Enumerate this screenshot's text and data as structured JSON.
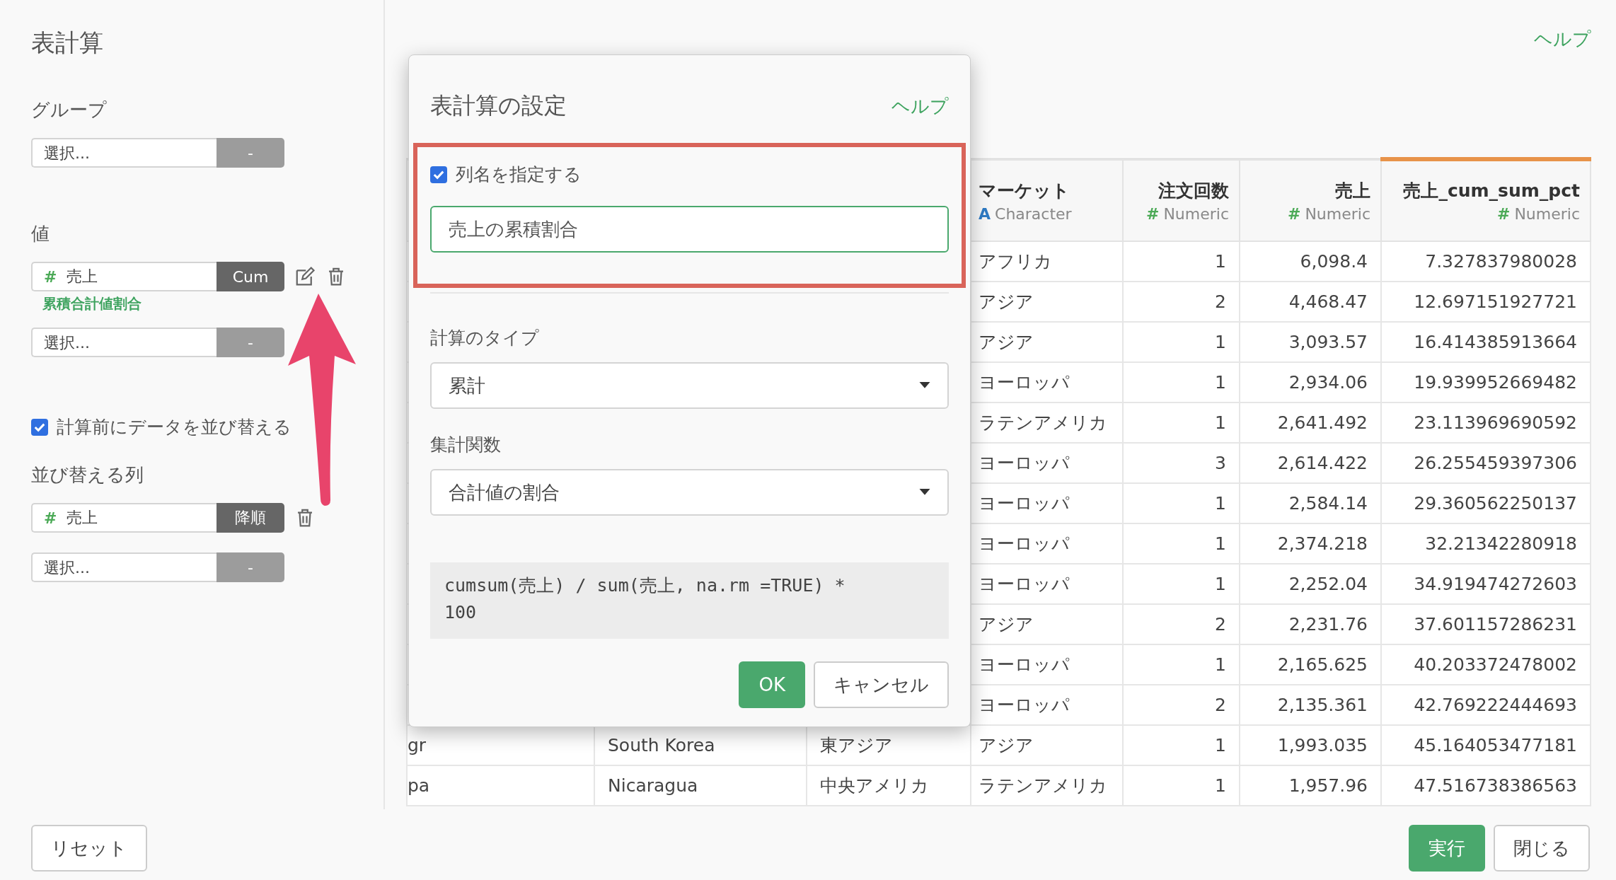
{
  "page": {
    "title": "表計算",
    "help_link": "ヘルプ"
  },
  "sidebar": {
    "group": {
      "label": "グループ",
      "items": [
        {
          "kind": "empty",
          "placeholder": "選択...",
          "button": "-"
        }
      ]
    },
    "values": {
      "label": "値",
      "items": [
        {
          "kind": "field",
          "type_icon": "#",
          "value": "売上",
          "button": "Cum",
          "note": "累積合計値割合",
          "editable": true
        },
        {
          "kind": "empty",
          "placeholder": "選択...",
          "button": "-"
        }
      ]
    },
    "sort_option": {
      "label": "計算前にデータを並び替える",
      "checked": true
    },
    "sort_columns": {
      "label": "並び替える列",
      "items": [
        {
          "kind": "field",
          "type_icon": "#",
          "value": "売上",
          "button": "降順",
          "editable": false
        },
        {
          "kind": "empty",
          "placeholder": "選択...",
          "button": "-"
        }
      ]
    }
  },
  "table": {
    "columns": [
      {
        "name": "マーケット",
        "kind": "character",
        "type_icon": "A",
        "type": "Character",
        "highlighted": false
      },
      {
        "name": "注文回数",
        "kind": "numeric",
        "type_icon": "#",
        "type": "Numeric",
        "highlighted": false
      },
      {
        "name": "売上",
        "kind": "numeric",
        "type_icon": "#",
        "type": "Numeric",
        "highlighted": false
      },
      {
        "name": "売上_cum_sum_pct",
        "kind": "numeric",
        "type_icon": "#",
        "type": "Numeric",
        "highlighted": true
      }
    ],
    "rows": [
      {
        "market": "アフリカ",
        "orders": "1",
        "sales": "6,098.4",
        "pct": "7.327837980028"
      },
      {
        "market": "アジア",
        "orders": "2",
        "sales": "4,468.47",
        "pct": "12.697151927721"
      },
      {
        "market": "アジア",
        "orders": "1",
        "sales": "3,093.57",
        "pct": "16.414385913664"
      },
      {
        "market": "ヨーロッパ",
        "orders": "1",
        "sales": "2,934.06",
        "pct": "19.939952669482"
      },
      {
        "market": "ラテンアメリカ",
        "orders": "1",
        "sales": "2,641.492",
        "pct": "23.113969690592"
      },
      {
        "market": "ヨーロッパ",
        "orders": "3",
        "sales": "2,614.422",
        "pct": "26.255459397306"
      },
      {
        "market": "ヨーロッパ",
        "orders": "1",
        "sales": "2,584.14",
        "pct": "29.360562250137"
      },
      {
        "market": "ヨーロッパ",
        "orders": "1",
        "sales": "2,374.218",
        "pct": "32.21342280918"
      },
      {
        "market": "ヨーロッパ",
        "orders": "1",
        "sales": "2,252.04",
        "pct": "34.919474272603"
      },
      {
        "market": "アジア",
        "orders": "2",
        "sales": "2,231.76",
        "pct": "37.601157286231"
      },
      {
        "market": "ヨーロッパ",
        "orders": "1",
        "sales": "2,165.625",
        "pct": "40.203372478002"
      },
      {
        "market": "ヨーロッパ",
        "orders": "2",
        "sales": "2,135.361",
        "pct": "42.769222444693"
      },
      {
        "column_1": "gr",
        "column_2": "South Korea",
        "column_3": "東アジア",
        "market": "アジア",
        "orders": "1",
        "sales": "1,993.035",
        "pct": "45.164053477181"
      },
      {
        "column_1": "pa",
        "column_2": "Nicaragua",
        "column_3": "中央アメリカ",
        "market": "ラテンアメリカ",
        "orders": "1",
        "sales": "1,957.96",
        "pct": "47.516738386563"
      }
    ]
  },
  "dialog": {
    "title": "表計算の設定",
    "help_link": "ヘルプ",
    "name_option": {
      "label": "列名を指定する",
      "checked": true
    },
    "name_input": {
      "value": "売上の累積割合"
    },
    "calc_type": {
      "label": "計算のタイプ",
      "value": "累計"
    },
    "aggregate": {
      "label": "集計関数",
      "value": "合計値の割合"
    },
    "formula": "cumsum(売上) / sum(売上, na.rm =TRUE) * 100",
    "buttons": [
      {
        "label": "OK",
        "kind": "primary"
      },
      {
        "label": "キャンセル",
        "kind": "default"
      }
    ]
  },
  "footer": {
    "buttons": [
      {
        "label": "リセット",
        "kind": "default"
      },
      {
        "label": "実行",
        "kind": "primary"
      },
      {
        "label": "閉じる",
        "kind": "default"
      }
    ]
  }
}
